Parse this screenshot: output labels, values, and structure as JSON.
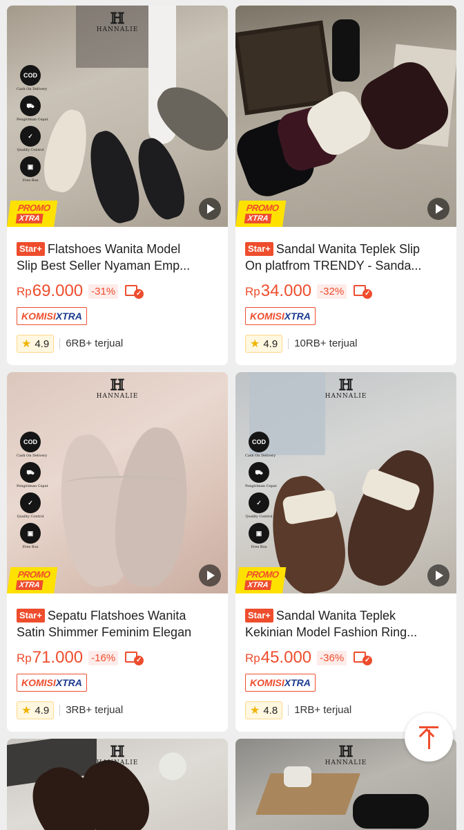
{
  "brand": {
    "mark": "ℍ",
    "name": "HANNALIE"
  },
  "badges": [
    {
      "icon": "cod-icon",
      "label": "Cash On Delivery",
      "text": "COD"
    },
    {
      "icon": "delivery-truck-icon",
      "label": "Pengiriman Cepat",
      "text": ""
    },
    {
      "icon": "check-icon",
      "label": "Quality Control",
      "text": "✓"
    },
    {
      "icon": "box-icon",
      "label": "Free Box",
      "text": "▣"
    }
  ],
  "promo": {
    "top": "PROMO",
    "bottom": "XTRA"
  },
  "komisi": {
    "part1": "KOMISI",
    "part2": "XTRA"
  },
  "star_tag": "Star+",
  "currency": "Rp",
  "products": [
    {
      "title1": "Flatshoes Wanita Model",
      "title2": "Slip Best Seller Nyaman Emp...",
      "price": "69.000",
      "discount": "-31%",
      "rating": "4.9",
      "sold": "6RB+ terjual"
    },
    {
      "title1": "Sandal Wanita Teplek Slip",
      "title2": "On platfrom TRENDY - Sanda...",
      "price": "34.000",
      "discount": "-32%",
      "rating": "4.9",
      "sold": "10RB+ terjual"
    },
    {
      "title1": "Sepatu Flatshoes Wanita",
      "title2": "Satin Shimmer Feminim Elegan",
      "price": "71.000",
      "discount": "-16%",
      "rating": "4.9",
      "sold": "3RB+ terjual"
    },
    {
      "title1": "Sandal Wanita Teplek",
      "title2": "Kekinian Model Fashion Ring...",
      "price": "45.000",
      "discount": "-36%",
      "rating": "4.8",
      "sold": "1RB+ terjual"
    }
  ],
  "colors": {
    "accent": "#ee4d2d",
    "promo_yellow": "#ffe100",
    "komisi_blue": "#1c3b8f",
    "star": "#f0b400"
  }
}
